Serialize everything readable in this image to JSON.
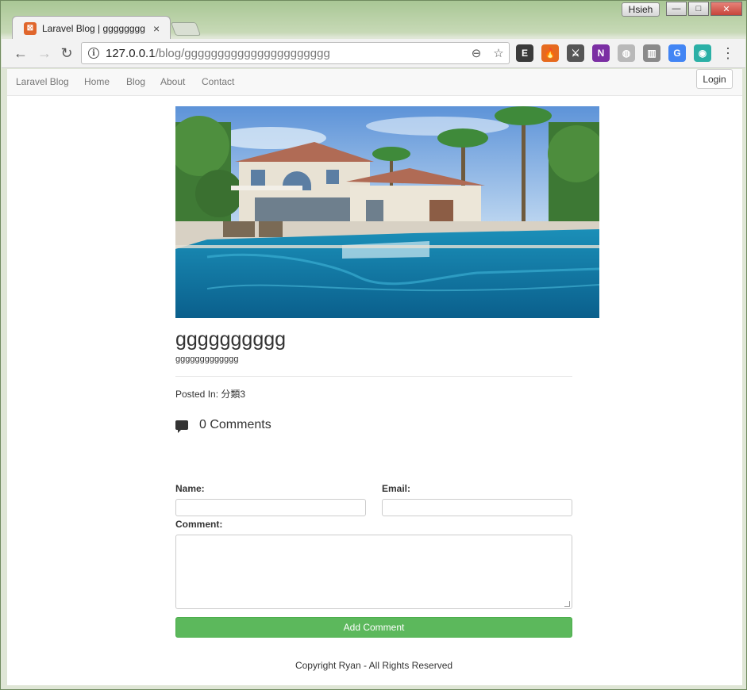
{
  "window": {
    "user_label": "Hsieh",
    "minimize_glyph": "—",
    "maximize_glyph": "□",
    "close_glyph": "✕"
  },
  "browser": {
    "tab_title": "Laravel Blog | gggggggg",
    "tab_close_glyph": "×",
    "url_host": "127.0.0.1",
    "url_path": "/blog/gggggggggggggggggggggg",
    "back_glyph": "←",
    "forward_glyph": "→",
    "reload_glyph": "↻",
    "zoom_icon": "⊖",
    "star_icon": "☆",
    "menu_glyph": "⋮",
    "extensions": [
      {
        "name": "evernote-icon",
        "glyph": "E",
        "color": "#3a3a3a"
      },
      {
        "name": "fire-icon",
        "glyph": "🔥",
        "color": "#e66a1e"
      },
      {
        "name": "sword-icon",
        "glyph": "⚔",
        "color": "#555555"
      },
      {
        "name": "onenote-icon",
        "glyph": "N",
        "color": "#7b2fa3"
      },
      {
        "name": "globe-icon",
        "glyph": "◍",
        "color": "#b9b9b9"
      },
      {
        "name": "barcode-icon",
        "glyph": "▥",
        "color": "#8a8a8a"
      },
      {
        "name": "translate-icon",
        "glyph": "G",
        "color": "#4285f4"
      },
      {
        "name": "eye-icon",
        "glyph": "◉",
        "color": "#2bb0a6"
      }
    ]
  },
  "navbar": {
    "brand": "Laravel Blog",
    "links": [
      "Home",
      "Blog",
      "About",
      "Contact"
    ],
    "login": "Login"
  },
  "post": {
    "title": "gggggggggg",
    "body": "ggggggggggggg",
    "posted_in_label": "Posted In: 分類3",
    "comments_count": "0 Comments"
  },
  "form": {
    "name_label": "Name:",
    "email_label": "Email:",
    "comment_label": "Comment:",
    "name_value": "",
    "email_value": "",
    "comment_value": "",
    "submit_label": "Add Comment"
  },
  "footer": {
    "text": "Copyright Ryan - All Rights Reserved"
  },
  "colors": {
    "submit_bg": "#5cb85c",
    "favicon_bg": "#e0662c"
  }
}
